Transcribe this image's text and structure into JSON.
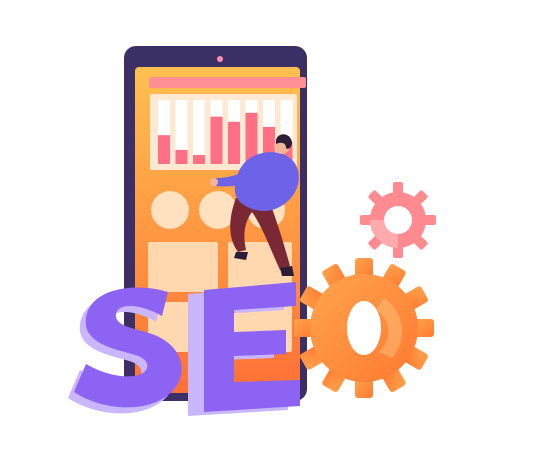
{
  "illustration": {
    "lettering": "SEO",
    "colors": {
      "phone_frame": "#3b2f66",
      "screen_top": "#ffb84a",
      "screen_bottom": "#ff7a3c",
      "panel": "#ffe3c2",
      "header_bar": "#ff8f95",
      "chart_bar": "#ff6f86",
      "letters_front": "#8c63f2",
      "letters_side": "#bca5ff",
      "gear_large": "#ff8a3d",
      "gear_small": "#ff8a8f",
      "person_shirt": "#6d63e8",
      "person_pants": "#7a2836",
      "person_hair": "#2b1d35"
    },
    "chart_bars": [
      {
        "bg": 1.0,
        "fill": 0.45
      },
      {
        "bg": 1.0,
        "fill": 0.22
      },
      {
        "bg": 1.0,
        "fill": 0.14
      },
      {
        "bg": 1.0,
        "fill": 0.74
      },
      {
        "bg": 1.0,
        "fill": 0.66
      },
      {
        "bg": 1.0,
        "fill": 0.8
      },
      {
        "bg": 1.0,
        "fill": 0.58
      },
      {
        "bg": 1.0,
        "fill": 0.34
      }
    ]
  }
}
